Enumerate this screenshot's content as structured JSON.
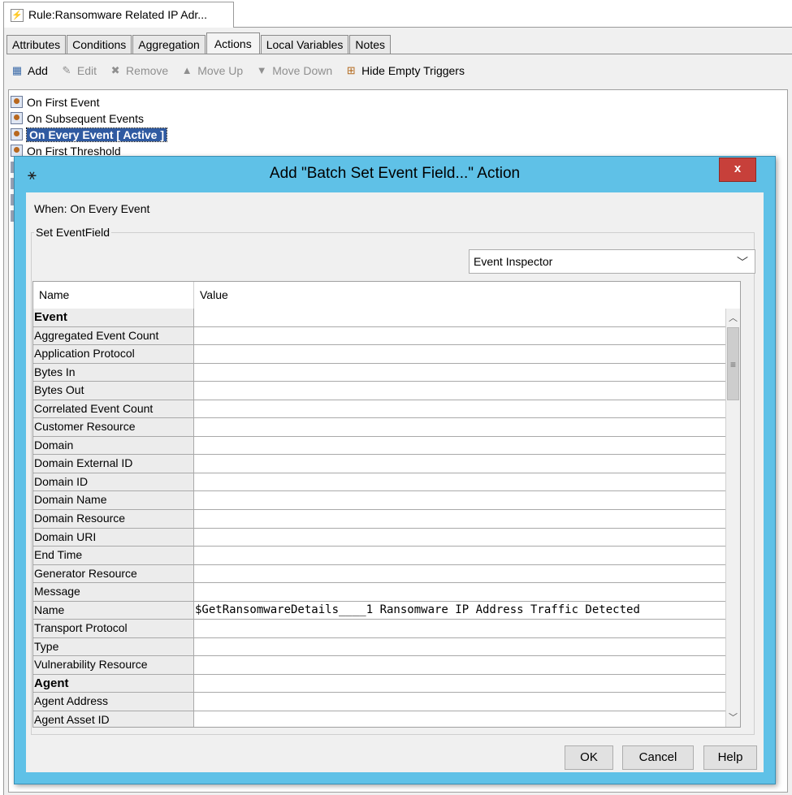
{
  "document_tab": {
    "title": "Rule:Ransomware Related IP Adr..."
  },
  "tabs": [
    {
      "label": "Attributes"
    },
    {
      "label": "Conditions"
    },
    {
      "label": "Aggregation"
    },
    {
      "label": "Actions",
      "active": true
    },
    {
      "label": "Local Variables"
    },
    {
      "label": "Notes"
    }
  ],
  "toolbar": {
    "add": "Add",
    "edit": "Edit",
    "remove": "Remove",
    "move_up": "Move Up",
    "move_down": "Move Down",
    "hide_empty": "Hide Empty Triggers"
  },
  "triggers": [
    {
      "label": "On First Event"
    },
    {
      "label": "On Subsequent Events"
    },
    {
      "label": "On Every Event [ Active ]",
      "selected": true
    },
    {
      "label": "On First Threshold"
    }
  ],
  "dialog": {
    "title": "Add \"Batch Set Event Field...\" Action",
    "close_label": "x",
    "when": "When: On Every Event",
    "fieldset_legend": "Set EventField",
    "inspector": {
      "selected": "Event Inspector"
    },
    "grid": {
      "col_name": "Name",
      "col_value": "Value",
      "rows": [
        {
          "name": "Event",
          "value": "",
          "category": true
        },
        {
          "name": "Aggregated Event Count",
          "value": ""
        },
        {
          "name": "Application Protocol",
          "value": ""
        },
        {
          "name": "Bytes In",
          "value": ""
        },
        {
          "name": "Bytes Out",
          "value": ""
        },
        {
          "name": "Correlated Event Count",
          "value": ""
        },
        {
          "name": "Customer Resource",
          "value": ""
        },
        {
          "name": "Domain",
          "value": ""
        },
        {
          "name": "Domain External ID",
          "value": ""
        },
        {
          "name": "Domain ID",
          "value": ""
        },
        {
          "name": "Domain Name",
          "value": ""
        },
        {
          "name": "Domain Resource",
          "value": ""
        },
        {
          "name": "Domain URI",
          "value": ""
        },
        {
          "name": "End Time",
          "value": ""
        },
        {
          "name": "Generator Resource",
          "value": ""
        },
        {
          "name": "Message",
          "value": ""
        },
        {
          "name": "Name",
          "value": "$GetRansomwareDetails____1 Ransomware IP Address Traffic Detected"
        },
        {
          "name": "Transport Protocol",
          "value": ""
        },
        {
          "name": "Type",
          "value": ""
        },
        {
          "name": "Vulnerability Resource",
          "value": ""
        },
        {
          "name": "Agent",
          "value": "",
          "category": true
        },
        {
          "name": "Agent Address",
          "value": ""
        },
        {
          "name": "Agent Asset ID",
          "value": ""
        }
      ]
    },
    "buttons": {
      "ok": "OK",
      "cancel": "Cancel",
      "help": "Help"
    }
  }
}
